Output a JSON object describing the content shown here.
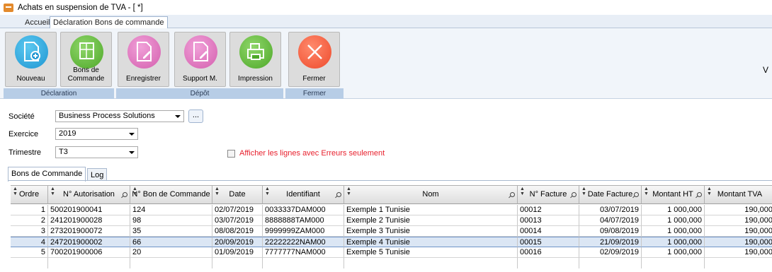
{
  "window": {
    "title": "Achats en suspension de TVA - [ *]"
  },
  "top_tabs": [
    {
      "label": "Accueil",
      "active": false
    },
    {
      "label": "Déclaration Bons de commande",
      "active": true
    }
  ],
  "ribbon": {
    "buttons": [
      {
        "label": "Nouveau",
        "icon": "new-document-icon",
        "color": "blue"
      },
      {
        "label": "Bons de\nCommande",
        "icon": "purchase-orders-icon",
        "color": "green"
      },
      {
        "label": "Enregistrer",
        "icon": "edit-document-icon",
        "color": "pink"
      },
      {
        "label": "Support M.",
        "icon": "support-document-icon",
        "color": "pink"
      },
      {
        "label": "Impression",
        "icon": "print-icon",
        "color": "green"
      },
      {
        "label": "Fermer",
        "icon": "close-icon",
        "color": "red"
      }
    ],
    "groups": [
      "Déclaration",
      "Dépôt",
      "Fermer"
    ],
    "corner_text": "V"
  },
  "form": {
    "societe": {
      "label": "Société",
      "value": "Business Process Solutions",
      "browse_label": "..."
    },
    "exercice": {
      "label": "Exercice",
      "value": "2019"
    },
    "trimestre": {
      "label": "Trimestre",
      "value": "T3"
    },
    "errors_only": {
      "label": "Afficher les lignes avec Erreurs seulement",
      "checked": false
    }
  },
  "inner_tabs": [
    {
      "label": "Bons de Commande",
      "active": true
    },
    {
      "label": "Log",
      "active": false
    }
  ],
  "grid": {
    "columns": [
      "Ordre",
      "N° Autorisation",
      "N° Bon de Commande",
      "Date",
      "Identifiant",
      "Nom",
      "N° Facture",
      "Date Facture",
      "Montant HT",
      "Montant TVA"
    ],
    "rows": [
      [
        "1",
        "500201900041",
        "124",
        "02/07/2019",
        "0033337DAM000",
        "Exemple 1 Tunisie",
        "00012",
        "03/07/2019",
        "1 000,000",
        "190,000"
      ],
      [
        "2",
        "241201900028",
        "98",
        "03/07/2019",
        "8888888TAM000",
        "Exemple 2 Tunisie",
        "00013",
        "04/07/2019",
        "1 000,000",
        "190,000"
      ],
      [
        "3",
        "273201900072",
        "35",
        "08/08/2019",
        "9999999ZAM000",
        "Exemple 3 Tunisie",
        "00014",
        "09/08/2019",
        "1 000,000",
        "190,000"
      ],
      [
        "4",
        "247201900002",
        "66",
        "20/09/2019",
        "22222222NAM00",
        "Exemple 4 Tunisie",
        "00015",
        "21/09/2019",
        "1 000,000",
        "190,000"
      ],
      [
        "5",
        "700201900006",
        "20",
        "01/09/2019",
        "7777777NAM000",
        "Exemple 5 Tunisie",
        "00016",
        "02/09/2019",
        "1 000,000",
        "190,000"
      ]
    ],
    "selected_row": 3
  }
}
